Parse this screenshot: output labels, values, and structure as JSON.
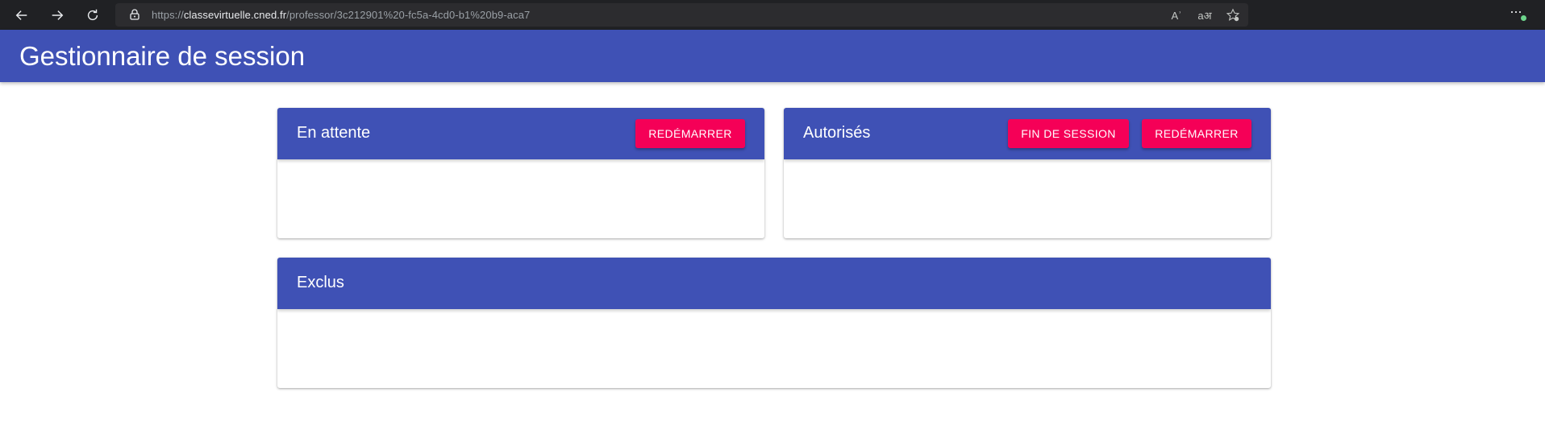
{
  "browser": {
    "url_scheme": "https://",
    "url_host": "classevirtuelle.cned.fr",
    "url_path": "/professor/3c212901%20-fc5a-4cd0-b1%20b9-aca7",
    "icons": [
      "back-icon",
      "forward-icon",
      "refresh-icon",
      "lock-icon",
      "read-aloud-icon",
      "translate-icon",
      "favorite-icon",
      "menu-icon"
    ],
    "read_aloud_glyph": "Aʾ",
    "translate_glyph": "aअ"
  },
  "app": {
    "title": "Gestionnaire de session",
    "primary_color": "#3f51b5",
    "accent_color": "#f50057"
  },
  "panels": {
    "waiting": {
      "title": "En attente",
      "restart_label": "REDÉMARRER"
    },
    "authorized": {
      "title": "Autorisés",
      "end_session_label": "FIN DE SESSION",
      "restart_label": "REDÉMARRER"
    },
    "excluded": {
      "title": "Exclus"
    }
  }
}
